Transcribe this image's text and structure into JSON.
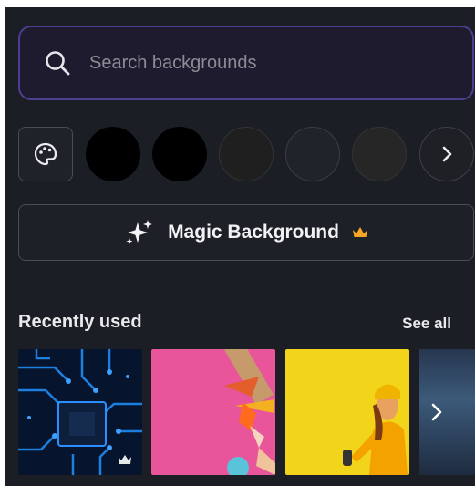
{
  "search": {
    "placeholder": "Search backgrounds",
    "icon": "search-icon"
  },
  "colors": {
    "palette_icon": "palette-icon",
    "swatches": [
      "#000000",
      "#000000",
      "#1f1f1f",
      "#20232a",
      "#262626"
    ],
    "more_icon": "chevron-right-icon"
  },
  "magic": {
    "label": "Magic Background",
    "icon": "sparkle-icon",
    "badge_icon": "crown-icon",
    "badge_color": "#f5a623"
  },
  "recent": {
    "title": "Recently used",
    "see_all": "See all",
    "items": [
      {
        "name": "circuit-board-background",
        "premium": true
      },
      {
        "name": "pink-craft-tools-background",
        "premium": false
      },
      {
        "name": "yellow-woman-headphones-background",
        "premium": false
      },
      {
        "name": "blue-abstract-background",
        "premium": false
      }
    ],
    "more_icon": "chevron-right-icon"
  }
}
